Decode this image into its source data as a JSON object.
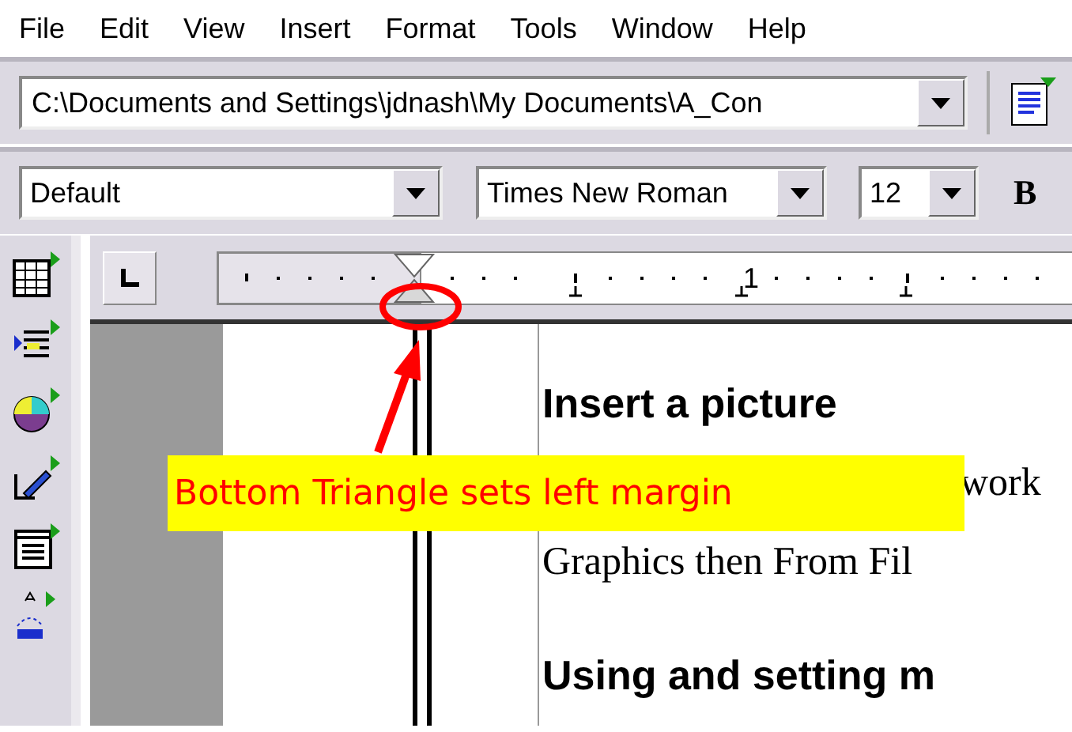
{
  "menu": [
    {
      "label": "File"
    },
    {
      "label": "Edit"
    },
    {
      "label": "View"
    },
    {
      "label": "Insert"
    },
    {
      "label": "Format"
    },
    {
      "label": "Tools"
    },
    {
      "label": "Window"
    },
    {
      "label": "Help"
    }
  ],
  "path_box": {
    "value": "C:\\Documents and Settings\\jdnash\\My Documents\\A_Con"
  },
  "style_box": {
    "value": "Default"
  },
  "font_box": {
    "value": "Times New Roman"
  },
  "size_box": {
    "value": "12"
  },
  "bold_button": {
    "label": "B"
  },
  "ruler": {
    "label": "1"
  },
  "document": {
    "lines": [
      {
        "kind": "heading",
        "text": "Insert a picture"
      },
      {
        "kind": "tail",
        "text": "work"
      },
      {
        "kind": "body",
        "text": "Graphics then From Fil"
      },
      {
        "kind": "heading",
        "text": "Using and setting m"
      }
    ]
  },
  "callout": {
    "text": "Bottom Triangle sets left margin"
  }
}
